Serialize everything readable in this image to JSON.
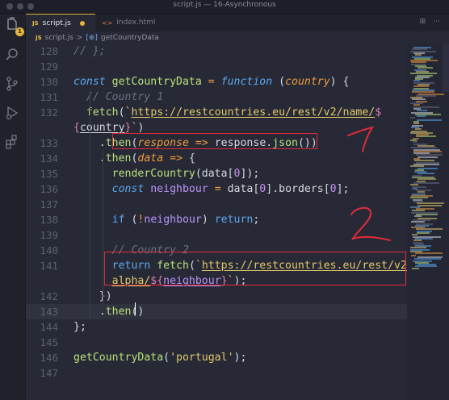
{
  "window": {
    "title": "script.js — 16-Asynchronous"
  },
  "activity_bar": {
    "icons": [
      "files-icon",
      "search-icon",
      "source-control-icon",
      "run-debug-icon",
      "extensions-icon"
    ],
    "badge": "1"
  },
  "tabs": [
    {
      "label": "script.js",
      "type": "js",
      "glyph": "JS",
      "active": true,
      "dirty": true
    },
    {
      "label": "index.html",
      "type": "html",
      "glyph": "<>",
      "active": false,
      "dirty": false
    }
  ],
  "breadcrumb": {
    "file_glyph": "JS",
    "file": "script.js",
    "separator": ">",
    "symbol_glyph": "[⊕]",
    "symbol": "getCountryData"
  },
  "editor": {
    "lines": [
      {
        "n": "128",
        "tokens": [
          [
            "cm",
            "// };"
          ]
        ]
      },
      {
        "n": "129",
        "tokens": []
      },
      {
        "n": "130",
        "tokens": [
          [
            "kw-it",
            "const "
          ],
          [
            "fn",
            "getCountryData"
          ],
          [
            "pn",
            " "
          ],
          [
            "op",
            "="
          ],
          [
            "pn",
            " "
          ],
          [
            "kw-it",
            "function"
          ],
          [
            "pn",
            " ("
          ],
          [
            "param",
            "country"
          ],
          [
            "pn",
            ") {"
          ]
        ]
      },
      {
        "n": "131",
        "tokens": [
          [
            "pn",
            "  "
          ],
          [
            "cm",
            "// Country 1"
          ]
        ]
      },
      {
        "n": "132",
        "tokens": [
          [
            "pn",
            "  "
          ],
          [
            "fn",
            "fetch"
          ],
          [
            "pn",
            "("
          ],
          [
            "str",
            "`"
          ],
          [
            "str ul",
            "https://restcountries.eu/rest/v2/name/"
          ],
          [
            "tmpl",
            "$"
          ]
        ]
      },
      {
        "n": "",
        "tokens": [
          [
            "tmpl",
            "{"
          ],
          [
            "pn ul",
            "country"
          ],
          [
            "tmpl",
            "}"
          ],
          [
            "str",
            "`"
          ],
          [
            "pn",
            ")"
          ]
        ]
      },
      {
        "n": "133",
        "tokens": [
          [
            "pn",
            "    ."
          ],
          [
            "fn",
            "then"
          ],
          [
            "pn",
            "("
          ],
          [
            "param",
            "response"
          ],
          [
            "pn",
            " "
          ],
          [
            "op",
            "=>"
          ],
          [
            "pn",
            " response."
          ],
          [
            "fn",
            "json"
          ],
          [
            "pn",
            "())"
          ]
        ]
      },
      {
        "n": "134",
        "tokens": [
          [
            "pn",
            "    ."
          ],
          [
            "fn",
            "then"
          ],
          [
            "pn",
            "("
          ],
          [
            "param",
            "data"
          ],
          [
            "pn",
            " "
          ],
          [
            "op",
            "=>"
          ],
          [
            "pn",
            " {"
          ]
        ]
      },
      {
        "n": "135",
        "tokens": [
          [
            "pn",
            "      "
          ],
          [
            "fn",
            "renderCountry"
          ],
          [
            "pn",
            "(data["
          ],
          [
            "num",
            "0"
          ],
          [
            "pn",
            "]);"
          ]
        ]
      },
      {
        "n": "136",
        "tokens": [
          [
            "pn",
            "      "
          ],
          [
            "kw-it",
            "const "
          ],
          [
            "purple",
            "neighbour"
          ],
          [
            "pn",
            " "
          ],
          [
            "op",
            "="
          ],
          [
            "pn",
            " data["
          ],
          [
            "num",
            "0"
          ],
          [
            "pn",
            "].borders["
          ],
          [
            "num",
            "0"
          ],
          [
            "pn",
            "];"
          ]
        ]
      },
      {
        "n": "137",
        "tokens": []
      },
      {
        "n": "138",
        "tokens": [
          [
            "pn",
            "      "
          ],
          [
            "kw",
            "if"
          ],
          [
            "pn",
            " ("
          ],
          [
            "op",
            "!"
          ],
          [
            "purple",
            "neighbour"
          ],
          [
            "pn",
            ") "
          ],
          [
            "kw",
            "return"
          ],
          [
            "pn",
            ";"
          ]
        ]
      },
      {
        "n": "139",
        "tokens": []
      },
      {
        "n": "140",
        "tokens": [
          [
            "pn",
            "      "
          ],
          [
            "cm",
            "// Country 2"
          ]
        ]
      },
      {
        "n": "141",
        "tokens": [
          [
            "pn",
            "      "
          ],
          [
            "kw",
            "return"
          ],
          [
            "pn",
            " "
          ],
          [
            "fn",
            "fetch"
          ],
          [
            "pn",
            "("
          ],
          [
            "str",
            "`"
          ],
          [
            "str ul",
            "https://restcountries.eu/rest/v2/"
          ]
        ]
      },
      {
        "n": "",
        "tokens": [
          [
            "pn",
            "      "
          ],
          [
            "str ul",
            "alpha/"
          ],
          [
            "tmpl",
            "${"
          ],
          [
            "purple ul",
            "neighbour"
          ],
          [
            "tmpl",
            "}"
          ],
          [
            "str",
            "`"
          ],
          [
            "pn",
            ");"
          ]
        ]
      },
      {
        "n": "142",
        "tokens": [
          [
            "pn",
            "    })"
          ]
        ]
      },
      {
        "n": "143",
        "tokens": [
          [
            "pn",
            "    ."
          ],
          [
            "fn",
            "then"
          ],
          [
            "pn",
            "()"
          ]
        ]
      },
      {
        "n": "144",
        "tokens": [
          [
            "pn",
            "};"
          ]
        ]
      },
      {
        "n": "145",
        "tokens": []
      },
      {
        "n": "146",
        "tokens": [
          [
            "fn",
            "getCountryData"
          ],
          [
            "pn",
            "("
          ],
          [
            "str",
            "'portugal'"
          ],
          [
            "pn",
            ");"
          ]
        ]
      },
      {
        "n": "147",
        "tokens": []
      }
    ]
  },
  "annotations": {
    "marks": [
      "1",
      "2"
    ],
    "color": "#e02a3a"
  },
  "colors": {
    "accent": "#e5b43c",
    "background": "#272a36"
  }
}
